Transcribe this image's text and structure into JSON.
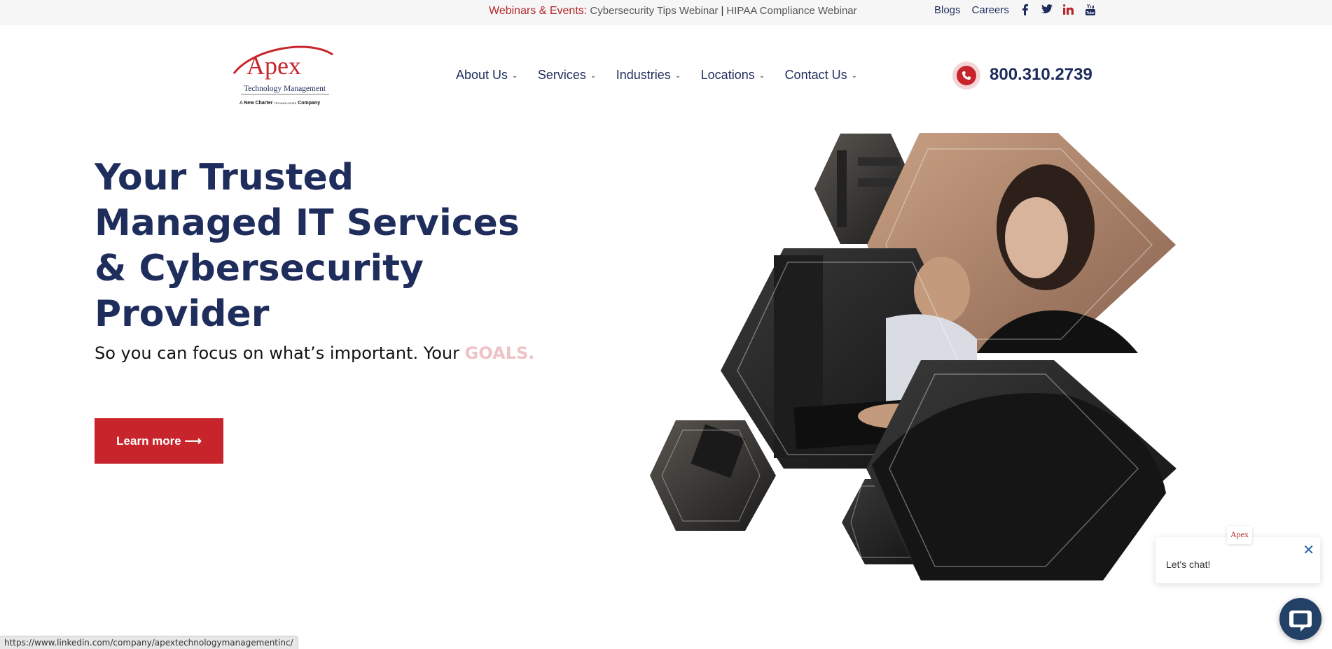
{
  "topbar": {
    "events_label": "Webinars & Events:",
    "events": [
      "Cybersecurity Tips Webinar",
      "HIPAA Compliance Webinar"
    ],
    "separator": "|",
    "links": [
      "Blogs",
      "Careers"
    ],
    "social": [
      {
        "name": "facebook-icon",
        "glyph": "f"
      },
      {
        "name": "twitter-icon",
        "glyph": "t"
      },
      {
        "name": "linkedin-icon",
        "glyph": "in"
      },
      {
        "name": "youtube-icon",
        "glyph": "You"
      }
    ]
  },
  "logo": {
    "name": "Apex",
    "subtitle": "Technology Management",
    "tagline_prefix": "A",
    "tagline_brand": "New Charter",
    "tagline_small": "TECHNOLOGIES",
    "tagline_suffix": "Company"
  },
  "nav": {
    "items": [
      "About Us",
      "Services",
      "Industries",
      "Locations",
      "Contact Us"
    ]
  },
  "phone": {
    "number": "800.310.2739"
  },
  "hero": {
    "title_lines": [
      "Your Trusted",
      "Managed IT Services",
      "& Cybersecurity",
      "Provider"
    ],
    "subtitle": "So you can focus on what’s important. Your",
    "subtitle_highlight": "GOALS.",
    "cta_label": "Learn more ⟶"
  },
  "chat": {
    "message": "Let's chat!",
    "close": "✕",
    "logo_text": "Apex"
  },
  "status_bar": {
    "url": "https://www.linkedin.com/company/apextechnologymanagementinc/"
  },
  "colors": {
    "navy": "#1f2d5c",
    "red": "#c8242c",
    "pink": "#eec3c6",
    "chat_blue": "#234066"
  }
}
